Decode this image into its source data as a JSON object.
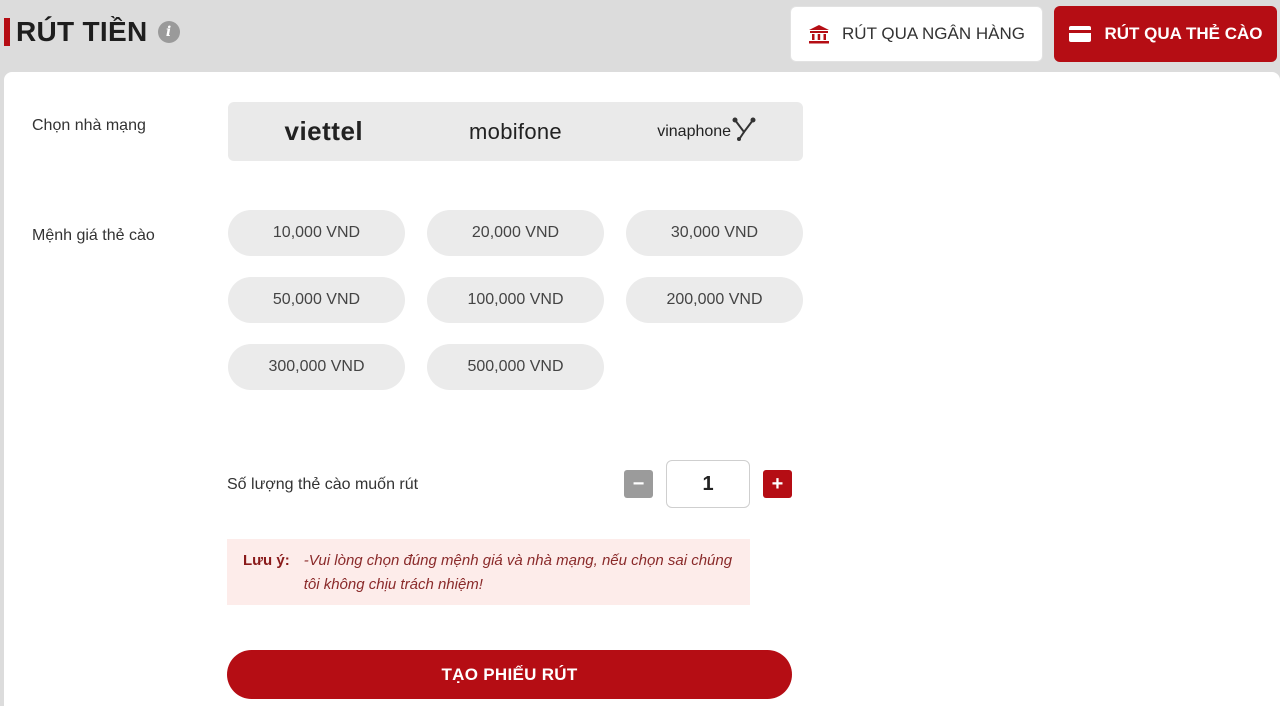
{
  "header": {
    "title": "RÚT TIỀN",
    "info_icon": "i"
  },
  "tabs": {
    "bank_label": "RÚT QUA NGÂN HÀNG",
    "card_label": "RÚT QUA THẺ CÀO",
    "active": "card"
  },
  "form": {
    "network_label": "Chọn nhà mạng",
    "networks": [
      "viettel",
      "mobifone",
      "vinaphone"
    ],
    "denomination_label": "Mệnh giá thẻ cào",
    "denominations": [
      "10,000 VND",
      "20,000 VND",
      "30,000 VND",
      "50,000 VND",
      "100,000 VND",
      "200,000 VND",
      "300,000 VND",
      "500,000 VND"
    ],
    "quantity_label": "Số lượng thẻ cào muốn rút",
    "quantity_value": "1",
    "minus_symbol": "−",
    "plus_symbol": "+"
  },
  "note": {
    "label": "Lưu ý:",
    "text": "-Vui lòng chọn đúng mệnh giá và nhà mạng, nếu chọn sai chúng tôi không chịu trách nhiệm!"
  },
  "submit_label": "TẠO PHIẾU RÚT",
  "colors": {
    "accent": "#b50d14",
    "background": "#dcdcdc",
    "pill": "#ebebeb"
  }
}
